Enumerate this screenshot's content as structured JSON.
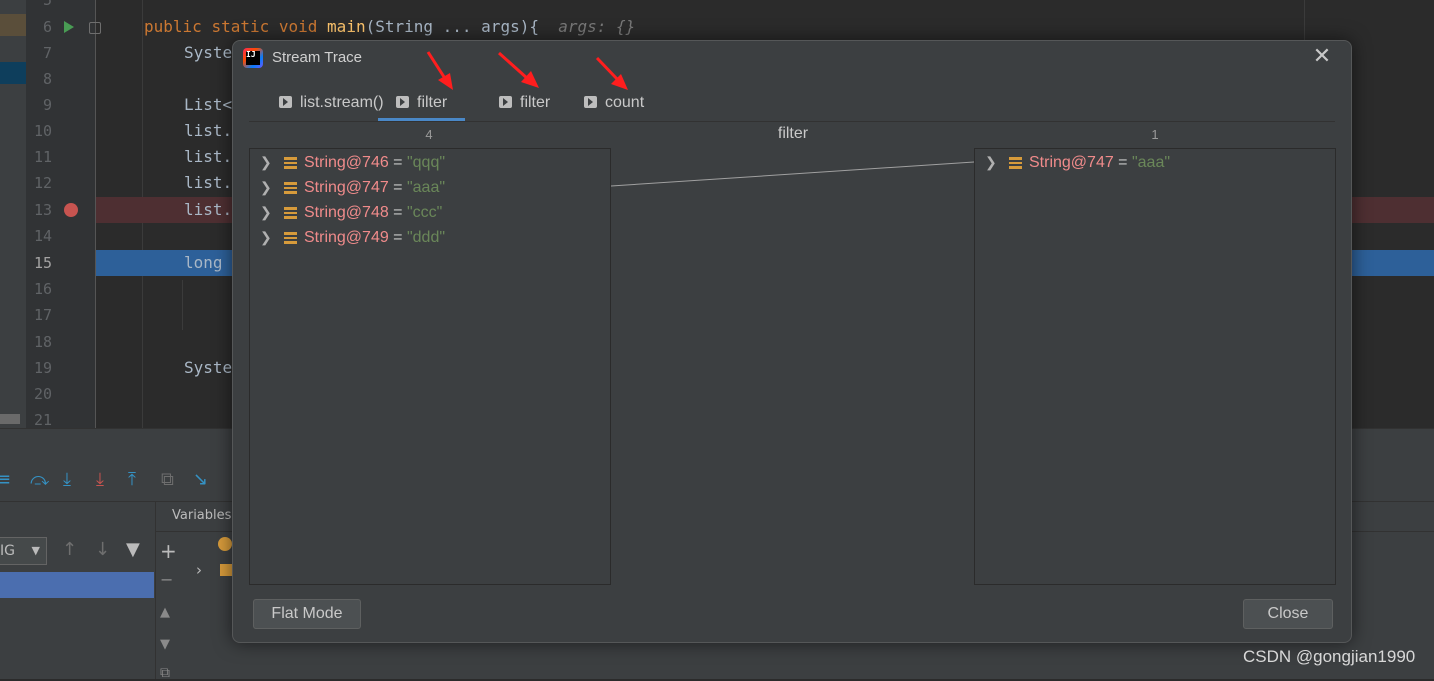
{
  "editor": {
    "lines": [
      {
        "num": "5",
        "code": ""
      },
      {
        "num": "6",
        "code_parts": [
          "public",
          "static",
          "void",
          "main",
          "(String ... args){",
          "args: {}"
        ]
      },
      {
        "num": "7",
        "code": "Syste"
      },
      {
        "num": "8",
        "code": ""
      },
      {
        "num": "9",
        "code": "List<"
      },
      {
        "num": "10",
        "code": "list."
      },
      {
        "num": "11",
        "code": "list."
      },
      {
        "num": "12",
        "code": "list."
      },
      {
        "num": "13",
        "code": "list."
      },
      {
        "num": "14",
        "code": ""
      },
      {
        "num": "15",
        "code": "long"
      },
      {
        "num": "16",
        "code": ""
      },
      {
        "num": "17",
        "code": ""
      },
      {
        "num": "18",
        "code": ""
      },
      {
        "num": "19",
        "code": "Syste"
      },
      {
        "num": "20",
        "code": ""
      },
      {
        "num": "21",
        "code": ""
      }
    ]
  },
  "debug_panel": {
    "variables_tab": "Variables",
    "frames_combo_value": "IG",
    "add_symbol": "+",
    "remove_symbol": "−"
  },
  "dialog": {
    "title": "Stream Trace",
    "close_symbol": "✕",
    "tabs": [
      {
        "label": "list.stream()"
      },
      {
        "label": "filter"
      },
      {
        "label": "filter"
      },
      {
        "label": "count"
      }
    ],
    "active_tab_index": 1,
    "left_count": "4",
    "middle_label": "filter",
    "right_count": "1",
    "left_items": [
      {
        "name": "String@746",
        "eq": " = ",
        "value": "\"qqq\""
      },
      {
        "name": "String@747",
        "eq": " = ",
        "value": "\"aaa\""
      },
      {
        "name": "String@748",
        "eq": " = ",
        "value": "\"ccc\""
      },
      {
        "name": "String@749",
        "eq": " = ",
        "value": "\"ddd\""
      }
    ],
    "right_items": [
      {
        "name": "String@747",
        "eq": " = ",
        "value": "\"aaa\""
      }
    ],
    "flat_mode_label": "Flat Mode",
    "close_label": "Close"
  },
  "watermark": "CSDN @gongjian1990",
  "colors": {
    "annotation_arrow": "#ff1e1e",
    "string_name": "#f08b8b",
    "string_value": "#6a8759",
    "active_tab_underline": "#4a88c7"
  }
}
